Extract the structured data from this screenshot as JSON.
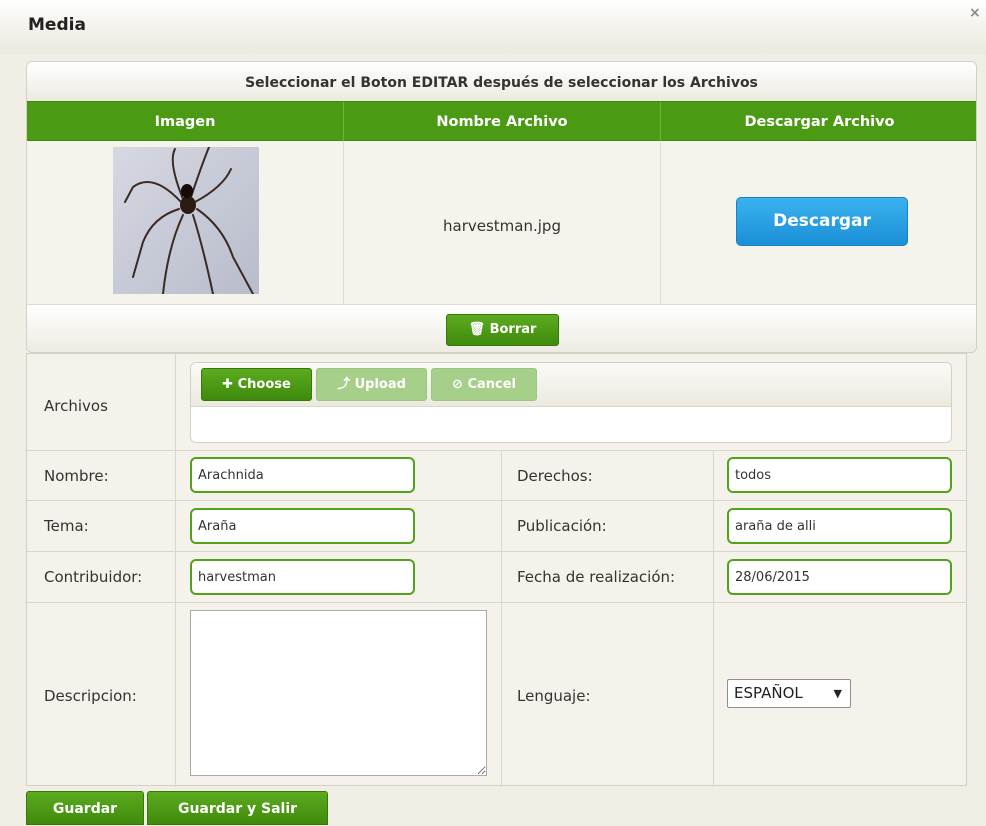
{
  "dialog": {
    "title": "Media",
    "close_glyph": "×"
  },
  "media": {
    "header": "Seleccionar el Boton EDITAR después de seleccionar los Archivos",
    "columns": [
      "Imagen",
      "Nombre Archivo",
      "Descargar Archivo"
    ],
    "file": {
      "image_icon": "spider-photo",
      "filename": "harvestman.jpg",
      "download_label": "Descargar"
    },
    "delete_label": "Borrar",
    "delete_icon": "trash-icon"
  },
  "form": {
    "archivos_label": "Archivos",
    "upload": {
      "choose_label": "Choose",
      "upload_label": "Upload",
      "cancel_label": "Cancel"
    },
    "nombre": {
      "label": "Nombre:",
      "value": "Arachnida"
    },
    "tema": {
      "label": "Tema:",
      "value": "Araña"
    },
    "contribuidor": {
      "label": "Contribuidor:",
      "value": "harvestman"
    },
    "descripcion": {
      "label": "Descripcion:",
      "value": ""
    },
    "derechos": {
      "label": "Derechos:",
      "value": "todos"
    },
    "publicacion": {
      "label": "Publicación:",
      "value": "araña de alli"
    },
    "fecha": {
      "label": "Fecha de realización:",
      "value": "28/06/2015"
    },
    "lenguaje": {
      "label": "Lenguaje:",
      "value": "ESPAÑOL"
    }
  },
  "actions": {
    "save_label": "Guardar",
    "save_exit_label": "Guardar y Salir"
  },
  "colors": {
    "green": "#4a9a14",
    "blue": "#1b8fd6",
    "background": "#f1eee5"
  }
}
